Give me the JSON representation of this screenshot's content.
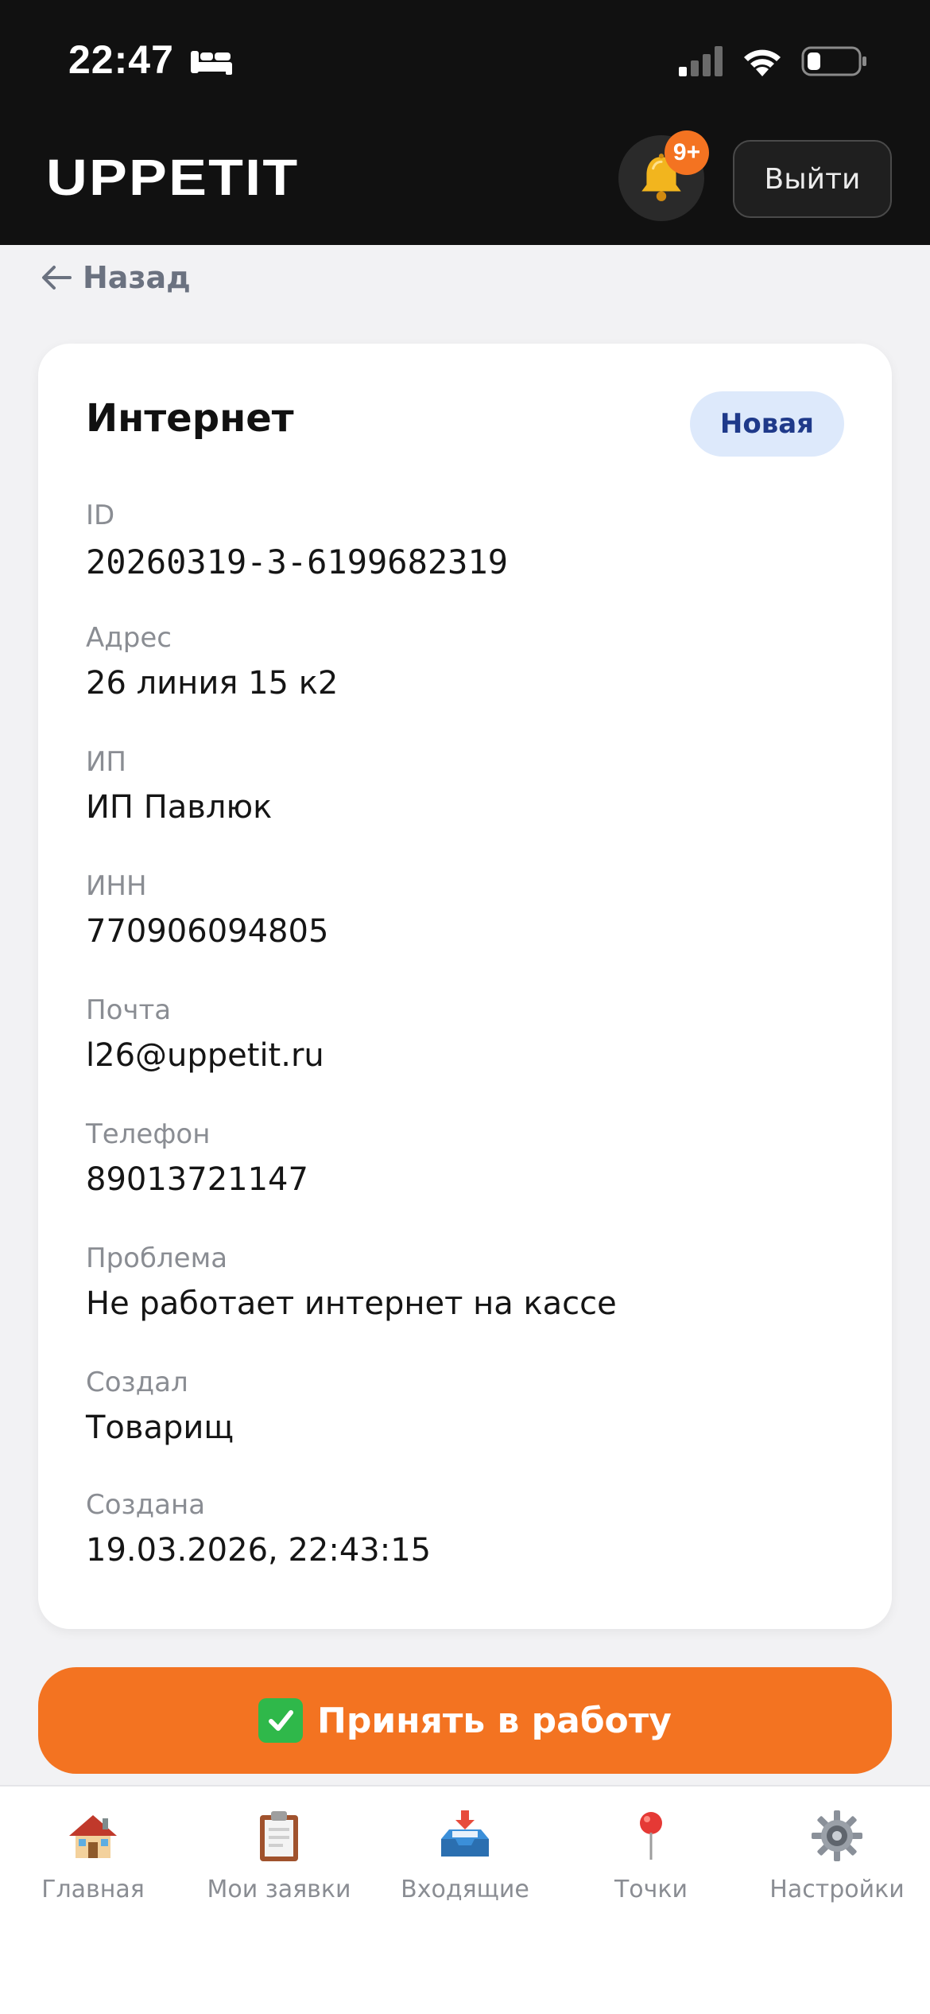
{
  "status_bar": {
    "time": "22:47"
  },
  "header": {
    "logo": "UPPETIT",
    "notifications_badge": "9+",
    "logout_label": "Выйти"
  },
  "back_label": "Назад",
  "ticket": {
    "title": "Интернет",
    "status": "Новая",
    "fields": [
      {
        "label": "ID",
        "value": "20260319-3-6199682319"
      },
      {
        "label": "Адрес",
        "value": "26 линия 15 к2"
      },
      {
        "label": "ИП",
        "value": "ИП Павлюк"
      },
      {
        "label": "ИНН",
        "value": "770906094805"
      },
      {
        "label": "Почта",
        "value": "l26@uppetit.ru"
      },
      {
        "label": "Телефон",
        "value": "89013721147"
      },
      {
        "label": "Проблема",
        "value": "Не работает интернет на кассе"
      },
      {
        "label": "Создал",
        "value": "Товарищ"
      },
      {
        "label": "Создана",
        "value": "19.03.2026, 22:43:15"
      }
    ]
  },
  "accept_button_label": "Принять в работу",
  "nav": [
    {
      "label": "Главная",
      "icon": "house-icon"
    },
    {
      "label": "Мои заявки",
      "icon": "clipboard-icon"
    },
    {
      "label": "Входящие",
      "icon": "inbox-tray-icon"
    },
    {
      "label": "Точки",
      "icon": "pushpin-icon"
    },
    {
      "label": "Настройки",
      "icon": "gear-icon"
    }
  ],
  "colors": {
    "accent": "#f37321",
    "header_bg": "#111111",
    "status_badge_bg": "#dde9fb",
    "status_badge_text": "#1f3a8a"
  }
}
